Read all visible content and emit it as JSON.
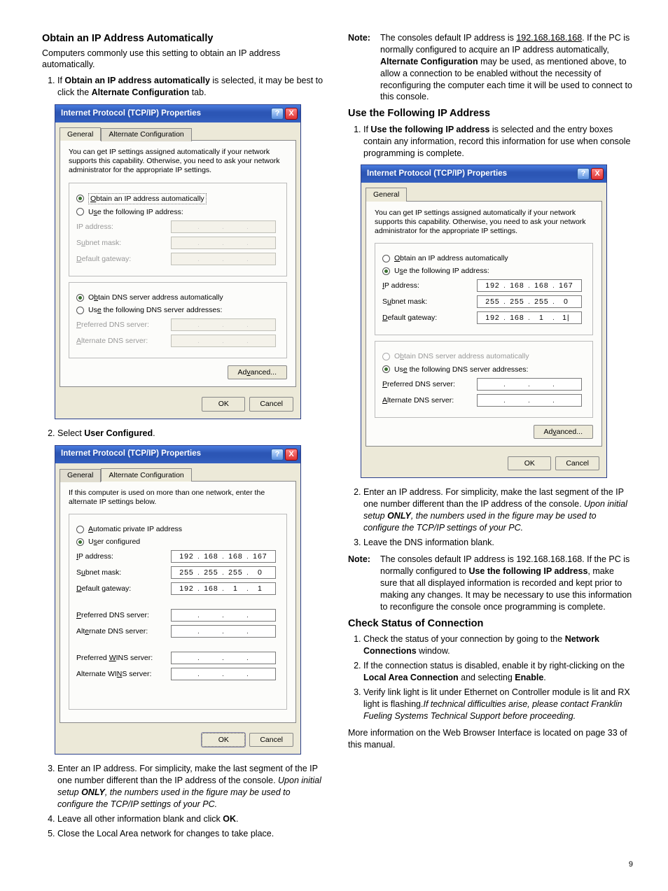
{
  "pageNumber": "9",
  "left": {
    "h_obtain": "Obtain an IP Address Automatically",
    "p_intro": "Computers commonly use this setting to obtain an IP address automatically.",
    "li1a": "If ",
    "li1b": "Obtain an IP address automatically",
    "li1c": " is selected, it may be best to click the ",
    "li1d": "Alternate Configuration",
    "li1e": " tab.",
    "li2a": "Select ",
    "li2b": "User Configured",
    "li2c": ".",
    "li3a": "Enter an IP address. For simplicity, make the last segment of the IP one number different than the IP address of the console. ",
    "li3b": "Upon initial setup ",
    "li3c": "ONLY",
    "li3d": ", the numbers used in the figure may be used to configure the TCP/IP settings of your PC.",
    "li4a": "Leave all other information blank and click ",
    "li4b": "OK",
    "li4c": ".",
    "li5": "Close the Local Area network for changes to take place."
  },
  "right": {
    "noteLabel": "Note:",
    "note1a": "The consoles default IP address is ",
    "note1b": "192.168.168.168",
    "note1c": ". If the PC is normally configured to acquire an IP address automatically, ",
    "note1d": "Alternate Configuration",
    "note1e": " may be used, as mentioned above, to allow a connection to be enabled without the necessity of reconfiguring the computer each time it will be used to connect to this console.",
    "h_use": "Use the Following IP Address",
    "r_li1a": "If ",
    "r_li1b": "Use the following IP address",
    "r_li1c": " is selected and the entry boxes contain any information, record this information for use when console programming is complete.",
    "r_li2a": "Enter an IP address. For simplicity, make the last segment of the IP one number different than the IP address of the console. ",
    "r_li2b": "Upon initial setup ",
    "r_li2c": "ONLY",
    "r_li2d": ", the numbers used in the figure may be used to configure the TCP/IP settings of your PC.",
    "r_li3": "Leave the DNS information blank.",
    "note2a": "The consoles default IP address is 192.168.168.168. If the PC is normally configured to ",
    "note2b": "Use the following IP address",
    "note2c": ", make sure that all displayed information is recorded and kept prior to making any changes. It may be necessary to use this information to reconfigure the console once programming is complete.",
    "h_check": "Check Status of Connection",
    "c_li1a": "Check the status of your connection by going to the ",
    "c_li1b": "Network Connections",
    "c_li1c": " window.",
    "c_li2a": "If the connection status is disabled, enable it by right-clicking on the ",
    "c_li2b": "Local Area Connection",
    "c_li2c": " and selecting ",
    "c_li2d": "Enable",
    "c_li2e": ".",
    "c_li3a": "Verify link light is lit under Ethernet on Controller module is lit and RX light is flashing.",
    "c_li3b": "If technical difficulties arise, please contact Franklin Fueling Systems Technical Support before proceeding.",
    "p_more": "More information on the Web Browser Interface is located on page 33 of this manual."
  },
  "dlg": {
    "title": "Internet Protocol (TCP/IP) Properties",
    "tabGeneral": "General",
    "tabAlt": "Alternate Configuration",
    "desc1": "You can get IP settings assigned automatically if your network supports this capability. Otherwise, you need to ask your network administrator for the appropriate IP settings.",
    "desc2": "If this computer is used on more than one network, enter the alternate IP settings below.",
    "rObtainIP": "Obtain an IP address automatically",
    "rUseIP": "Use the following IP address:",
    "rAutoPriv": "Automatic private IP address",
    "rUserConf": "User configured",
    "fIP": "IP address:",
    "fSubnet": "Subnet mask:",
    "fGateway": "Default gateway:",
    "rObtainDNS": "Obtain DNS server address automatically",
    "rUseDNS": "Use the following DNS server addresses:",
    "fPrefDNS": "Preferred DNS server:",
    "fAltDNS": "Alternate DNS server:",
    "fPrefWINS": "Preferred WINS server:",
    "fAltWINS": "Alternate WINS server:",
    "btnAdv": "Advanced...",
    "btnOK": "OK",
    "btnCancel": "Cancel",
    "help": "?",
    "close": "X",
    "ip": {
      "a": "192",
      "b": "168",
      "c": "168",
      "d": "167"
    },
    "mask": {
      "a": "255",
      "b": "255",
      "c": "255",
      "d": "0"
    },
    "gw": {
      "a": "192",
      "b": "168",
      "c": "1",
      "d": "1"
    },
    "gw2d": "1|"
  }
}
